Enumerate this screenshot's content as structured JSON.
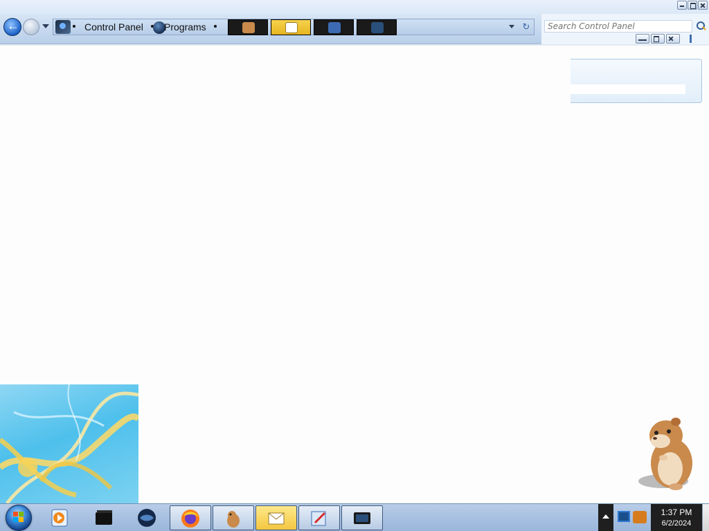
{
  "window": {
    "breadcrumb": [
      "Control Panel",
      "Programs"
    ],
    "search_placeholder": "Search Control Panel"
  },
  "taskbar": {
    "clock": {
      "time": "1:37 PM",
      "date": "6/2/2024"
    }
  }
}
